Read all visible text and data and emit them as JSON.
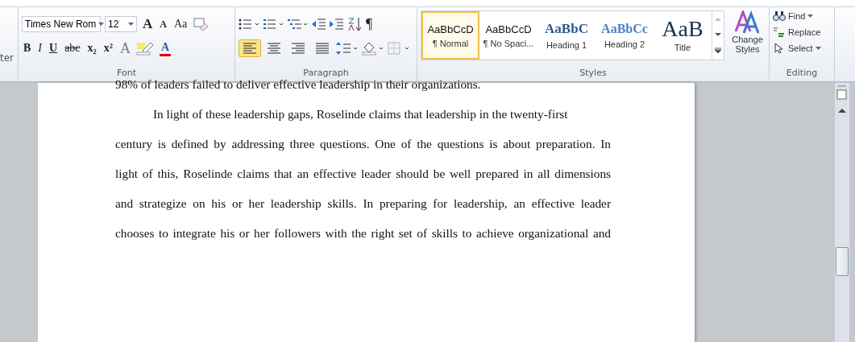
{
  "clipboard": {
    "label": "ter"
  },
  "font": {
    "face": "Times New Rom",
    "size": "12",
    "grow": "A",
    "shrink": "A",
    "change_case": "Aa",
    "bold": "B",
    "italic": "I",
    "underline": "U",
    "strike": "abc",
    "subscript": "x₂",
    "superscript": "x²",
    "text_effects": "A",
    "font_color": "A",
    "label": "Font"
  },
  "paragraph": {
    "align": [
      {
        "kind": "left",
        "selected": true
      },
      {
        "kind": "center",
        "selected": false
      },
      {
        "kind": "right",
        "selected": false
      },
      {
        "kind": "justify",
        "selected": false
      }
    ],
    "pilcrow": "¶",
    "label": "Paragraph"
  },
  "styles": {
    "items": [
      {
        "preview": "AaBbCcD",
        "name": "¶ Normal",
        "kind": "normal",
        "selected": true
      },
      {
        "preview": "AaBbCcD",
        "name": "¶ No Spaci...",
        "kind": "normal",
        "selected": false
      },
      {
        "preview": "AaBbC",
        "name": "Heading 1",
        "kind": "h1",
        "selected": false
      },
      {
        "preview": "AaBbCc",
        "name": "Heading 2",
        "kind": "h2",
        "selected": false
      },
      {
        "preview": "AaB",
        "name": "Title",
        "kind": "title",
        "selected": false
      }
    ],
    "change_styles": "Change Styles",
    "label": "Styles"
  },
  "editing": {
    "buttons": [
      {
        "kind": "find",
        "label": "Find",
        "dropdown": true
      },
      {
        "kind": "replace",
        "label": "Replace",
        "dropdown": false
      },
      {
        "kind": "select",
        "label": "Select",
        "dropdown": true
      }
    ],
    "label": "Editing"
  },
  "document": {
    "paragraphs": [
      {
        "indent": false,
        "lines": [
          "98% of leaders failed to deliver effective leadership in their organizations."
        ]
      },
      {
        "indent": true,
        "lines": [
          "In light of these leadership gaps, Roselinde claims that leadership in the twenty-first",
          "century is defined by addressing three questions. One of the questions is about preparation. In",
          "light of this, Roselinde claims that an effective leader should be well prepared in all dimensions",
          "and strategize on his or her leadership skills. In preparing for leadership, an effective leader",
          "chooses to integrate his or her followers with the right set of skills to achieve organizational and"
        ]
      }
    ]
  }
}
